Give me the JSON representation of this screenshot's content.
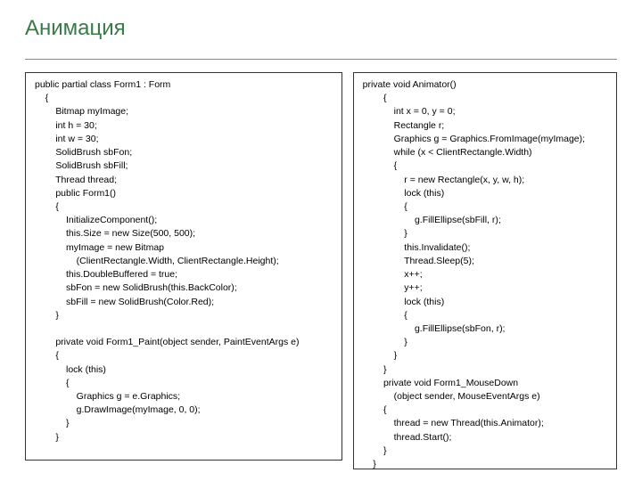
{
  "title": "Анимация",
  "code_left": "public partial class Form1 : Form\n    {\n        Bitmap myImage;\n        int h = 30;\n        int w = 30;\n        SolidBrush sbFon;\n        SolidBrush sbFill;\n        Thread thread;\n        public Form1()\n        {\n            InitializeComponent();\n            this.Size = new Size(500, 500);\n            myImage = new Bitmap\n                (ClientRectangle.Width, ClientRectangle.Height);\n            this.DoubleBuffered = true;\n            sbFon = new SolidBrush(this.BackColor);\n            sbFill = new SolidBrush(Color.Red);\n        }\n\n        private void Form1_Paint(object sender, PaintEventArgs e)\n        {\n            lock (this)\n            {\n                Graphics g = e.Graphics;\n                g.DrawImage(myImage, 0, 0);\n            }\n        }",
  "code_right": "private void Animator()\n        {\n            int x = 0, y = 0;\n            Rectangle r;\n            Graphics g = Graphics.FromImage(myImage);\n            while (x < ClientRectangle.Width)\n            {\n                r = new Rectangle(x, y, w, h);\n                lock (this)\n                {\n                    g.FillEllipse(sbFill, r);\n                }\n                this.Invalidate();\n                Thread.Sleep(5);\n                x++;\n                y++;\n                lock (this)\n                {\n                    g.FillEllipse(sbFon, r);\n                }\n            }\n        }\n        private void Form1_MouseDown\n            (object sender, MouseEventArgs e)\n        {\n            thread = new Thread(this.Animator);\n            thread.Start();\n        }\n    }"
}
